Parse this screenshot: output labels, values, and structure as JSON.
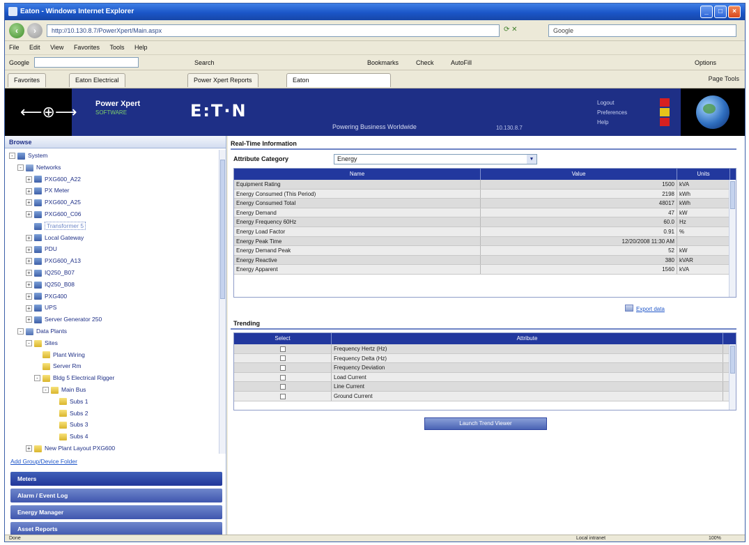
{
  "window": {
    "title": "Eaton - Windows Internet Explorer"
  },
  "address": {
    "url": "http://10.130.8.7/PowerXpert/Main.aspx",
    "search_placeholder": "Google"
  },
  "menus": [
    "File",
    "Edit",
    "View",
    "Favorites",
    "Tools",
    "Help"
  ],
  "toolbar": {
    "google_label": "Google",
    "items": [
      "Search",
      "Bookmarks",
      "Check",
      "AutoFill",
      "Options"
    ]
  },
  "tabs": [
    {
      "label": "Favorites"
    },
    {
      "label": "Eaton Electrical"
    },
    {
      "label": "Power Xpert Reports"
    },
    {
      "label": "Eaton"
    }
  ],
  "tab_tools": "Page  Tools",
  "header": {
    "product": "Power Xpert",
    "product_sub": "SOFTWARE",
    "brand": "E:T·N",
    "tagline": "Powering Business Worldwide",
    "ip": "10.130.8.7",
    "links": [
      "Logout",
      "Preferences",
      "Help"
    ],
    "status_colors": [
      "#d62020",
      "#e6c21a",
      "#d62020"
    ]
  },
  "left_panel": {
    "title": "Browse",
    "tree": [
      {
        "depth": 0,
        "toggle": "-",
        "icon": "pc",
        "label": "System"
      },
      {
        "depth": 1,
        "toggle": "-",
        "icon": "grp",
        "label": "Networks"
      },
      {
        "depth": 2,
        "toggle": "+",
        "icon": "pc",
        "label": "PXG600_A22"
      },
      {
        "depth": 2,
        "toggle": "+",
        "icon": "pc",
        "label": "PX Meter"
      },
      {
        "depth": 2,
        "toggle": "+",
        "icon": "pc",
        "label": "PXG600_A25"
      },
      {
        "depth": 2,
        "toggle": "+",
        "icon": "pc",
        "label": "PXG600_C06"
      },
      {
        "depth": 2,
        "toggle": "",
        "icon": "pc",
        "label": "Transformer 5",
        "selected": true
      },
      {
        "depth": 2,
        "toggle": "+",
        "icon": "pc",
        "label": "Local Gateway"
      },
      {
        "depth": 2,
        "toggle": "+",
        "icon": "pc",
        "label": "PDU"
      },
      {
        "depth": 2,
        "toggle": "+",
        "icon": "pc",
        "label": "PXG600_A13"
      },
      {
        "depth": 2,
        "toggle": "+",
        "icon": "pc",
        "label": "IQ250_B07"
      },
      {
        "depth": 2,
        "toggle": "+",
        "icon": "pc",
        "label": "IQ250_B08"
      },
      {
        "depth": 2,
        "toggle": "+",
        "icon": "pc",
        "label": "PXG400"
      },
      {
        "depth": 2,
        "toggle": "+",
        "icon": "pc",
        "label": "UPS"
      },
      {
        "depth": 2,
        "toggle": "+",
        "icon": "pc",
        "label": "Server Generator 250"
      },
      {
        "depth": 1,
        "toggle": "-",
        "icon": "grp",
        "label": "Data Plants"
      },
      {
        "depth": 2,
        "toggle": "-",
        "icon": "folder",
        "label": "Sites"
      },
      {
        "depth": 3,
        "toggle": "",
        "icon": "folder",
        "label": "Plant Wiring"
      },
      {
        "depth": 3,
        "toggle": "",
        "icon": "folder",
        "label": "Server Rm"
      },
      {
        "depth": 3,
        "toggle": "-",
        "icon": "folder",
        "label": "Bldg 5 Electrical Rigger"
      },
      {
        "depth": 4,
        "toggle": "-",
        "icon": "folder",
        "label": "Main Bus"
      },
      {
        "depth": 5,
        "toggle": "",
        "icon": "folder",
        "label": "Subs 1"
      },
      {
        "depth": 5,
        "toggle": "",
        "icon": "folder",
        "label": "Subs 2"
      },
      {
        "depth": 5,
        "toggle": "",
        "icon": "folder",
        "label": "Subs 3"
      },
      {
        "depth": 5,
        "toggle": "",
        "icon": "folder",
        "label": "Subs 4"
      },
      {
        "depth": 2,
        "toggle": "+",
        "icon": "folder",
        "label": "New Plant Layout PXG600"
      }
    ],
    "add_link": "Add Group/Device Folder",
    "accordions": [
      "Meters",
      "Alarm / Event Log",
      "Energy Manager",
      "Asset Reports"
    ]
  },
  "detail": {
    "title": "Real-Time Information",
    "category_label": "Attribute Category",
    "category_value": "Energy",
    "columns": [
      "Name",
      "Value",
      "Units"
    ],
    "rows": [
      [
        "Equipment Rating",
        "1500",
        "kVA"
      ],
      [
        "Energy Consumed (This Period)",
        "2198",
        "kWh"
      ],
      [
        "Energy Consumed Total",
        "48017",
        "kWh"
      ],
      [
        "Energy Demand",
        "47",
        "kW"
      ],
      [
        "Energy Frequency 60Hz",
        "60.0",
        "Hz"
      ],
      [
        "Energy Load Factor",
        "0.91",
        "%"
      ],
      [
        "Energy Peak Time",
        "12/20/2008 11:30 AM",
        ""
      ],
      [
        "Energy Demand Peak",
        "52",
        "kW"
      ],
      [
        "Energy Reactive",
        "380",
        "kVAR"
      ],
      [
        "Energy Apparent",
        "1560",
        "kVA"
      ]
    ],
    "export_label": "Export data",
    "trending_label": "Trending",
    "trend_columns": [
      "Select",
      "Attribute"
    ],
    "trend_rows": [
      [
        "",
        "Frequency Hertz (Hz)"
      ],
      [
        "",
        "Frequency Delta (Hz)"
      ],
      [
        "",
        "Frequency Deviation"
      ],
      [
        "",
        "Load Current"
      ],
      [
        "",
        "Line Current"
      ],
      [
        "",
        "Ground Current"
      ]
    ],
    "launch_button": "Launch Trend Viewer"
  },
  "statusbar": {
    "left": "Done",
    "zone": "Local intranet",
    "zoom": "100%"
  }
}
